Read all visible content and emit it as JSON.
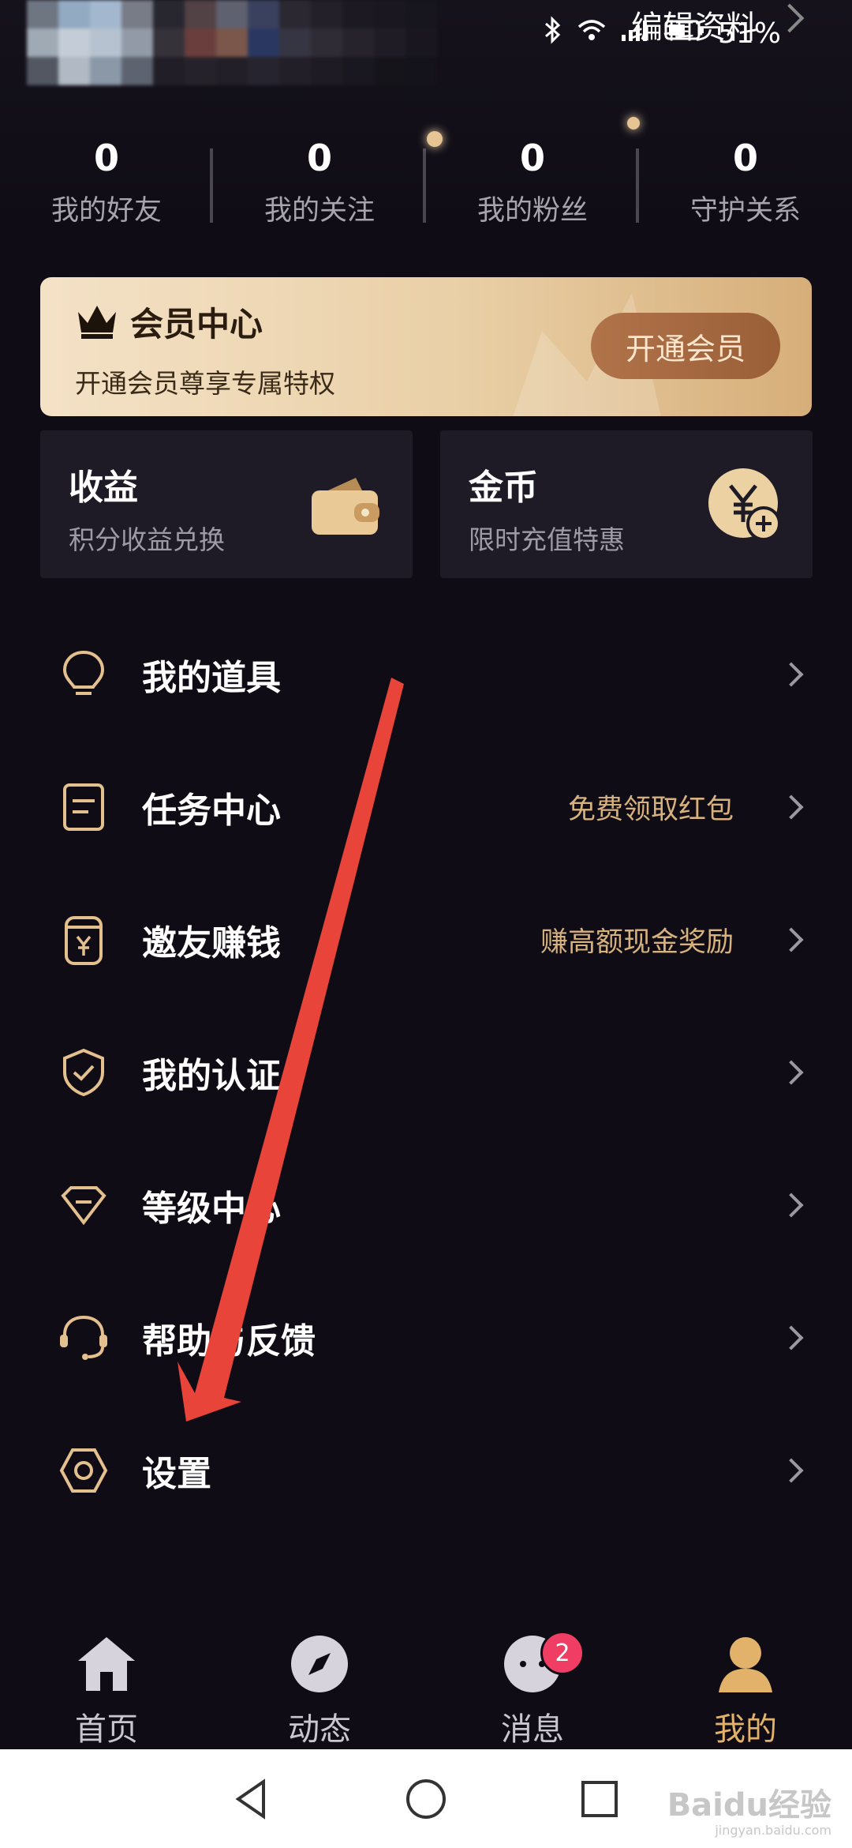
{
  "status_bar": {
    "edit_profile_label": "编辑资料",
    "battery": "51%"
  },
  "stats": [
    {
      "value": "0",
      "label": "我的好友"
    },
    {
      "value": "0",
      "label": "我的关注"
    },
    {
      "value": "0",
      "label": "我的粉丝"
    },
    {
      "value": "0",
      "label": "守护关系"
    }
  ],
  "vip": {
    "title": "会员中心",
    "subtitle": "开通会员尊享专属特权",
    "button_label": "开通会员"
  },
  "cards": {
    "income": {
      "title": "收益",
      "subtitle": "积分收益兑换",
      "icon": "wallet-icon"
    },
    "coins": {
      "title": "金币",
      "subtitle": "限时充值特惠",
      "icon": "yuan-coin-plus-icon"
    }
  },
  "menu": [
    {
      "label": "我的道具",
      "hint": "",
      "icon": "lightbulb-icon"
    },
    {
      "label": "任务中心",
      "hint": "免费领取红包",
      "icon": "task-list-icon"
    },
    {
      "label": "邀友赚钱",
      "hint": "赚高额现金奖励",
      "icon": "money-jar-icon"
    },
    {
      "label": "我的认证",
      "hint": "",
      "icon": "shield-check-icon"
    },
    {
      "label": "等级中心",
      "hint": "",
      "icon": "diamond-icon"
    },
    {
      "label": "帮助与反馈",
      "hint": "",
      "icon": "headset-icon"
    },
    {
      "label": "设置",
      "hint": "",
      "icon": "settings-hexagon-icon"
    }
  ],
  "tabs": [
    {
      "label": "首页",
      "icon": "home-icon",
      "active": false
    },
    {
      "label": "动态",
      "icon": "compass-icon",
      "active": false
    },
    {
      "label": "消息",
      "icon": "chat-bubble-icon",
      "active": false,
      "badge": "2"
    },
    {
      "label": "我的",
      "icon": "person-icon",
      "active": true
    }
  ],
  "colors": {
    "background": "#0f0c15",
    "accent_gold": "#d7b27d",
    "badge_red": "#ef3d63",
    "annotation_red": "#e8443a"
  },
  "watermark": {
    "brand": "Baidu经验",
    "domain": "jingyan.baidu.com"
  }
}
